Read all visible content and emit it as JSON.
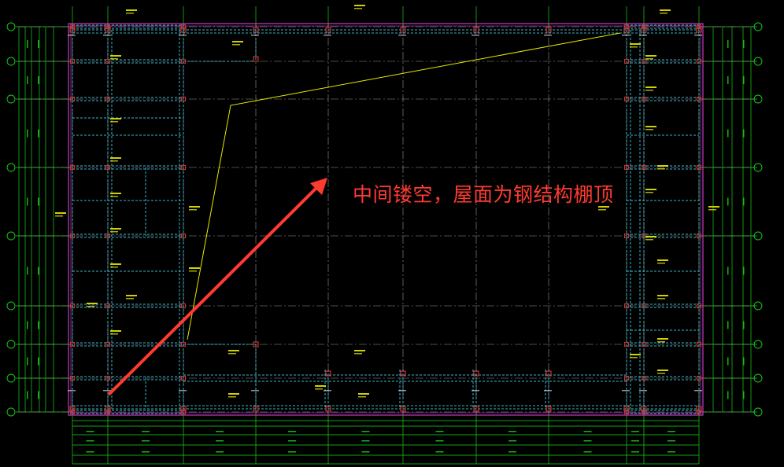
{
  "annotation": {
    "text": "中间镂空，屋面为钢结构棚顶",
    "color": "#ff3b30"
  },
  "colors": {
    "background": "#000000",
    "grid_axis": "#9a9a9a",
    "dimension": "#18d418",
    "boundary": "#c03cc0",
    "beam": "#3ab4c8",
    "column": "#c83232",
    "label": "#e8e800",
    "leader": "#e8e800",
    "arrow": "#ff3b30"
  }
}
